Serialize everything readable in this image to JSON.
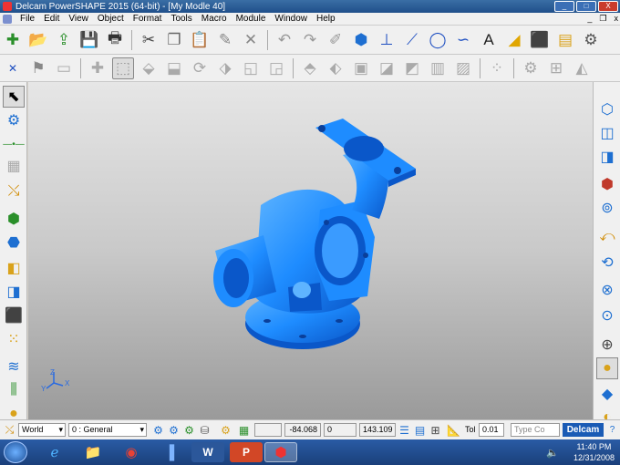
{
  "window": {
    "title": "Delcam PowerSHAPE 2015 (64-bit) - [My Modle 40]",
    "min_label": "_",
    "max_label": "□",
    "close_label": "X"
  },
  "menu": {
    "items": [
      "File",
      "Edit",
      "View",
      "Object",
      "Format",
      "Tools",
      "Macro",
      "Module",
      "Window",
      "Help"
    ],
    "mdi_min": "_",
    "mdi_restore": "❐",
    "mdi_close": "x"
  },
  "viewport": {
    "axis_x": "X",
    "axis_y": "Y",
    "axis_z": "Z",
    "model_color": "#1e8cff",
    "model_shadow": "#0a57c9"
  },
  "status": {
    "workplane": "World",
    "level": "0  : General",
    "x_value": "-84.068",
    "y_value": "0",
    "z_value": "143.109",
    "tol_label": "Tol",
    "tol_value": "0.01",
    "command_placeholder": "Type Co",
    "brand": "Delcam"
  },
  "taskbar": {
    "time": "11:40 PM",
    "date": "12/31/2008"
  }
}
